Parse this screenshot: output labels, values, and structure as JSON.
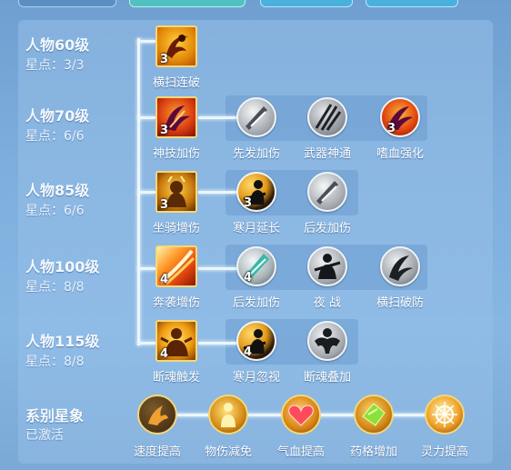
{
  "rows": [
    {
      "level": "人物60级",
      "points": "星点：3/3",
      "main": {
        "name": "横扫连破",
        "num": "3",
        "icon": "sweep-slash-icon"
      },
      "subs": []
    },
    {
      "level": "人物70级",
      "points": "星点：6/6",
      "main": {
        "name": "神技加伤",
        "num": "3",
        "icon": "claw-strike-icon"
      },
      "subs": [
        {
          "name": "先发加伤",
          "num": "",
          "icon": "blade-slash-icon"
        },
        {
          "name": "武器神通",
          "num": "",
          "icon": "triple-blade-icon"
        },
        {
          "name": "嗜血强化",
          "num": "3",
          "icon": "blood-claw-icon"
        }
      ]
    },
    {
      "level": "人物85级",
      "points": "星点：6/6",
      "main": {
        "name": "坐骑增伤",
        "num": "3",
        "icon": "mount-beast-icon"
      },
      "subs": [
        {
          "name": "寒月延长",
          "num": "3",
          "icon": "moon-warrior-icon"
        },
        {
          "name": "后发加伤",
          "num": "",
          "icon": "blade-slash-icon"
        }
      ]
    },
    {
      "level": "人物100级",
      "points": "星点：8/8",
      "main": {
        "name": "奔袭增伤",
        "num": "4",
        "icon": "flame-rush-icon"
      },
      "subs": [
        {
          "name": "后发加伤",
          "num": "4",
          "icon": "teal-blade-icon"
        },
        {
          "name": "夜 战",
          "num": "",
          "icon": "night-warrior-icon"
        },
        {
          "name": "横扫破防",
          "num": "",
          "icon": "sweep-break-icon"
        }
      ]
    },
    {
      "level": "人物115级",
      "points": "星点：8/8",
      "main": {
        "name": "断魂触发",
        "num": "4",
        "icon": "soul-burst-icon"
      },
      "subs": [
        {
          "name": "寒月忽视",
          "num": "4",
          "icon": "moon-warrior-icon"
        },
        {
          "name": "断魂叠加",
          "num": "",
          "icon": "muscle-silhouette-icon"
        }
      ]
    }
  ],
  "series": {
    "title": "系别星象",
    "status": "已激活",
    "items": [
      {
        "name": "速度提高",
        "icon": "speed-hand-icon"
      },
      {
        "name": "物伤减免",
        "icon": "golden-figure-icon"
      },
      {
        "name": "气血提高",
        "icon": "heart-icon"
      },
      {
        "name": "药格增加",
        "icon": "green-gem-icon"
      },
      {
        "name": "灵力提高",
        "icon": "spirit-wheel-icon"
      }
    ]
  },
  "colors": {
    "accent_gold": "#f5d878",
    "line": "#eaf6ff",
    "bg": "#7eaedc"
  }
}
